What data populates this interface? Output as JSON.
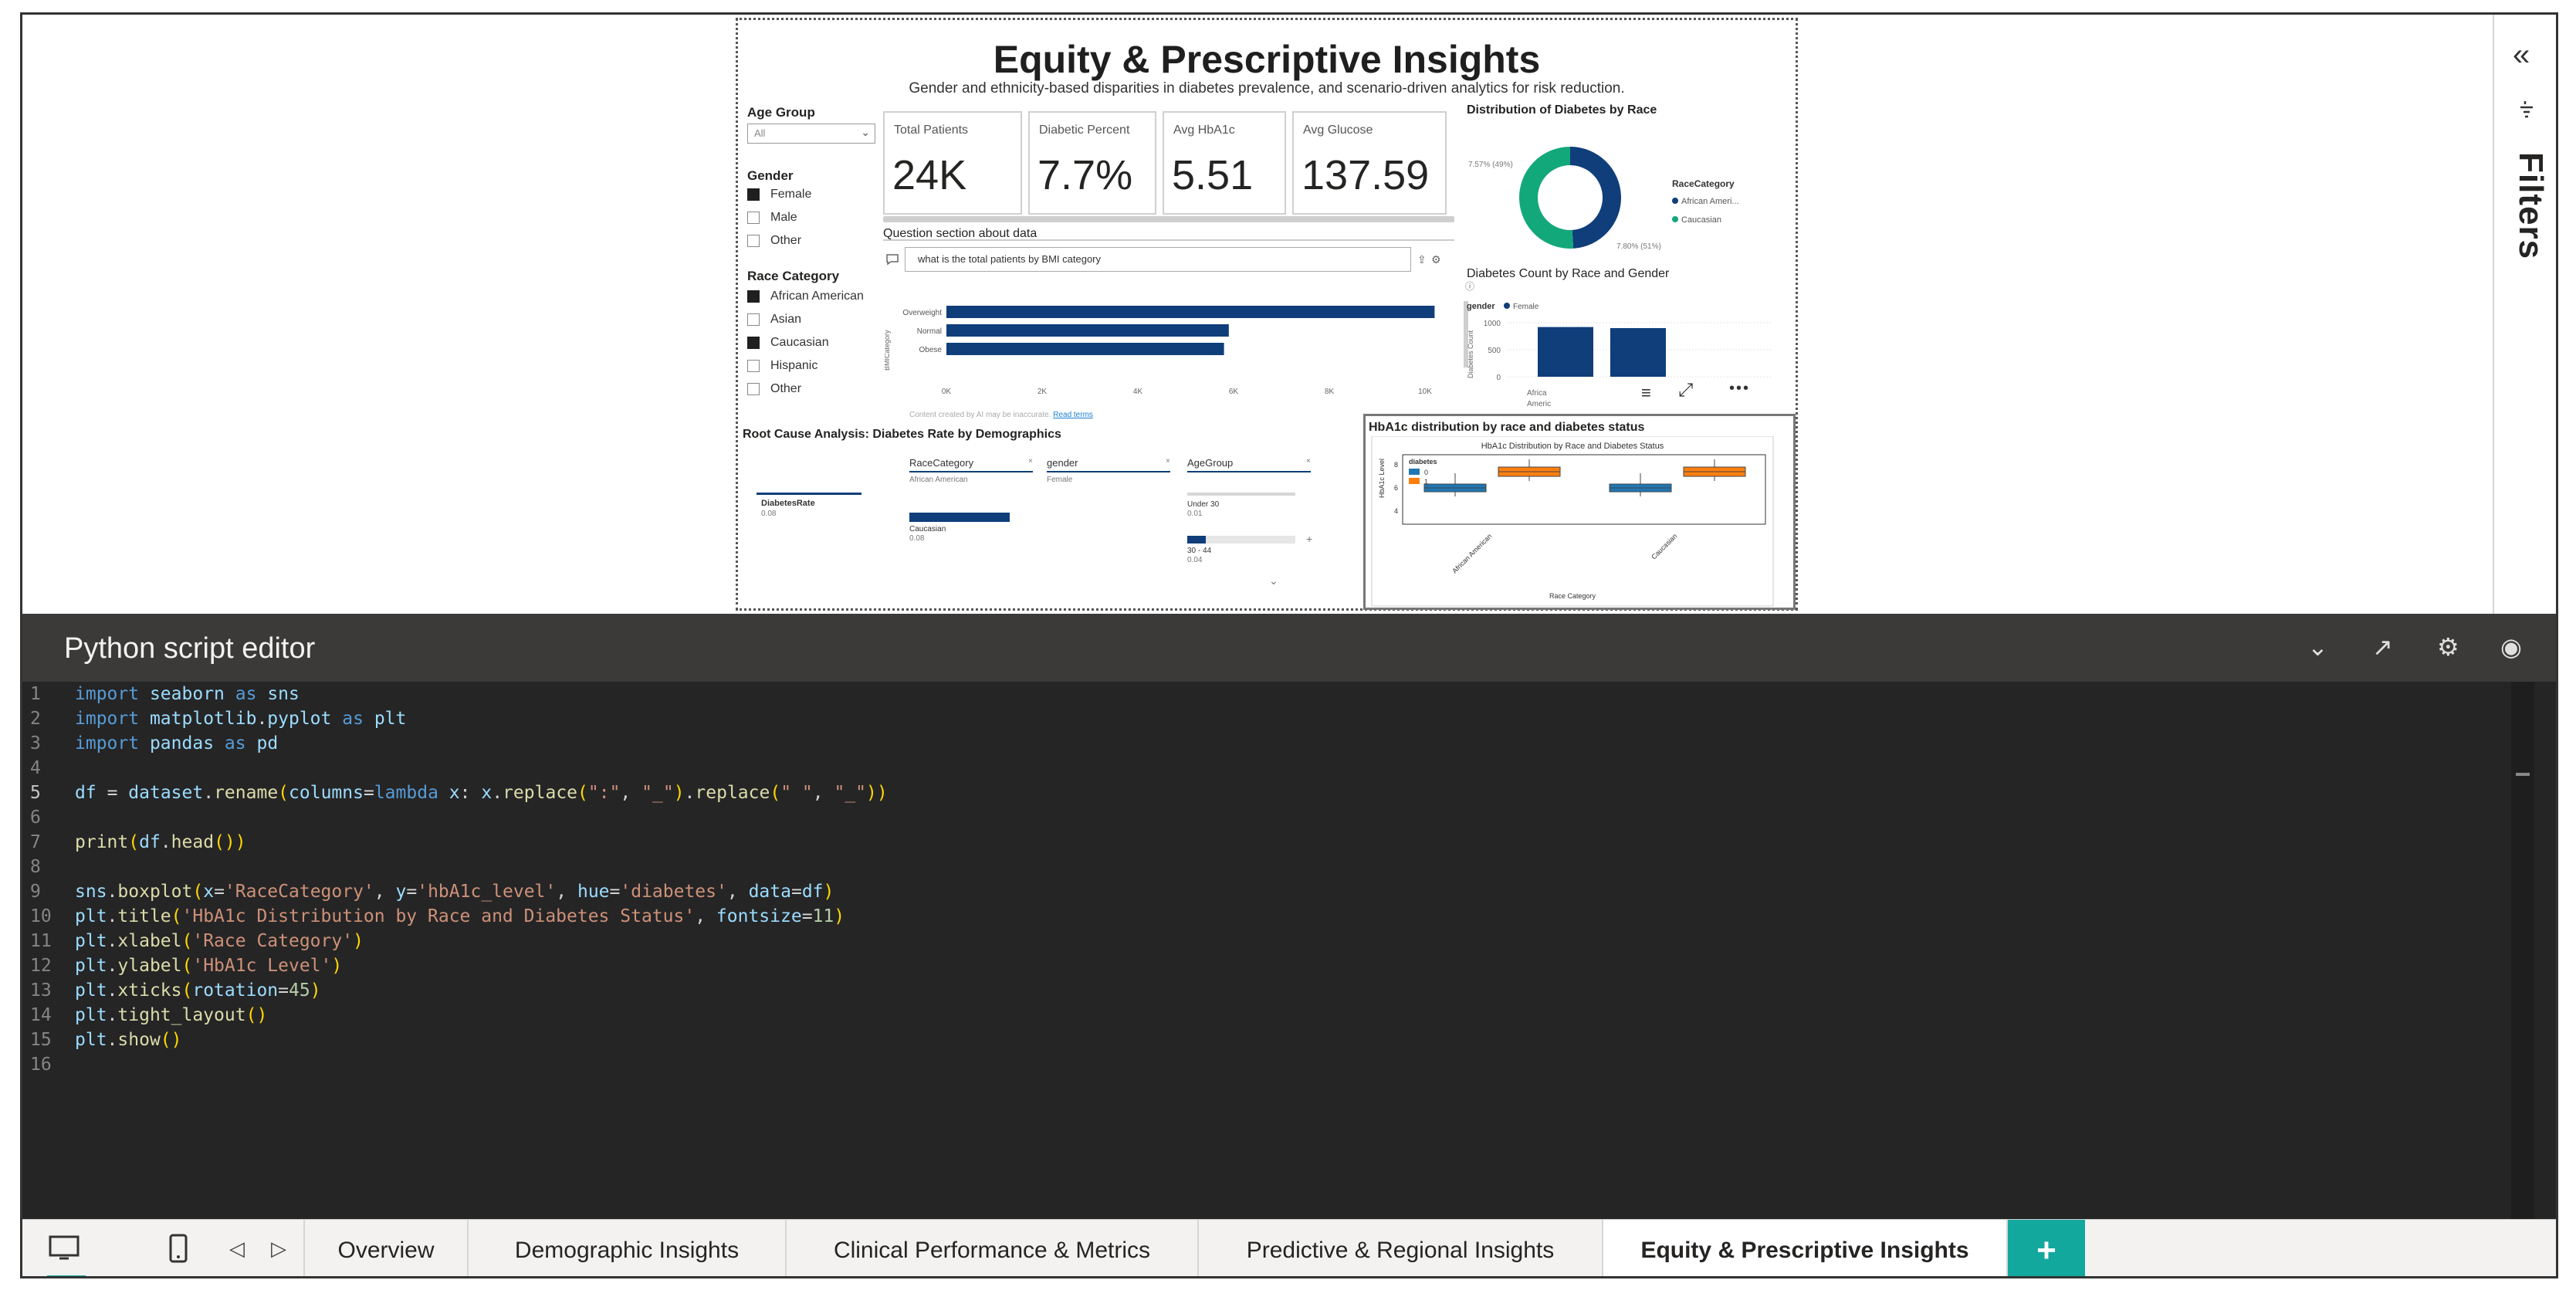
{
  "report": {
    "title": "Equity & Prescriptive Insights",
    "subtitle": "Gender and ethnicity-based disparities in diabetes prevalence, and scenario-driven analytics for risk reduction."
  },
  "slicers": {
    "age_group": {
      "title": "Age Group",
      "selected": "All"
    },
    "gender": {
      "title": "Gender",
      "options": [
        {
          "label": "Female",
          "checked": true
        },
        {
          "label": "Male",
          "checked": false
        },
        {
          "label": "Other",
          "checked": false
        }
      ]
    },
    "race": {
      "title": "Race Category",
      "options": [
        {
          "label": "African American",
          "checked": true
        },
        {
          "label": "Asian",
          "checked": false
        },
        {
          "label": "Caucasian",
          "checked": true
        },
        {
          "label": "Hispanic",
          "checked": false
        },
        {
          "label": "Other",
          "checked": false
        }
      ]
    }
  },
  "cards": [
    {
      "label": "Total Patients",
      "value": "24K"
    },
    {
      "label": "Diabetic Percent",
      "value": "7.7%"
    },
    {
      "label": "Avg HbA1c",
      "value": "5.51"
    },
    {
      "label": "Avg Glucose",
      "value": "137.59"
    }
  ],
  "qa": {
    "title": "Question section about data",
    "question": "what is the total patients by BMI category",
    "footer": "Content created by AI may be inaccurate.",
    "read_terms": "Read terms",
    "axis_label": "BMICategory",
    "chart_data": {
      "type": "bar",
      "orientation": "horizontal",
      "categories": [
        "Overweight",
        "Normal",
        "Obese"
      ],
      "values": [
        10200,
        5900,
        5800
      ],
      "xticks": [
        "0K",
        "2K",
        "4K",
        "6K",
        "8K",
        "10K"
      ],
      "xlim": [
        0,
        10000
      ],
      "color": "#0f3e7a"
    }
  },
  "donut": {
    "title": "Distribution of Diabetes by Race",
    "label_left": "7.57% (49%)",
    "label_right": "7.80% (51%)",
    "legend_title": "RaceCategory",
    "chart_data": {
      "type": "pie",
      "categories": [
        "African Ameri...",
        "Caucasian"
      ],
      "values": [
        49,
        51
      ],
      "colors": [
        "#0f3e7a",
        "#13a87a"
      ]
    }
  },
  "gender_bars": {
    "title": "Diabetes Count by Race and Gender",
    "legend_title": "gender",
    "legend_item": "Female",
    "ylabel": "Diabetes Count",
    "yticks": [
      "1000",
      "500",
      "0"
    ],
    "x_label_1": "Africa",
    "x_label_2": "Americ",
    "chart_data": {
      "type": "bar",
      "categories": [
        "African American",
        "Caucasian"
      ],
      "series": [
        {
          "name": "Female",
          "values": [
            920,
            900
          ]
        }
      ],
      "ylim": [
        0,
        1000
      ],
      "color": "#0f3e7a"
    }
  },
  "decomp": {
    "title": "Root Cause Analysis: Diabetes Rate by Demographics",
    "root_label": "DiabetesRate",
    "root_value": "0.08",
    "columns": [
      {
        "header": "RaceCategory",
        "sub": "African American"
      },
      {
        "header": "gender",
        "sub": "Female"
      },
      {
        "header": "AgeGroup",
        "sub": ""
      }
    ],
    "race_node": {
      "label": "Caucasian",
      "value": "0.08"
    },
    "age_nodes": [
      {
        "label": "Under 30",
        "value": "0.01"
      },
      {
        "label": "30 - 44",
        "value": "0.04"
      }
    ]
  },
  "boxplot": {
    "title": "HbA1c distribution by race and diabetes status",
    "inner_title": "HbA1c Distribution by Race and Diabetes Status",
    "xlabel": "Race Category",
    "ylabel": "HbA1c Level",
    "legend_title": "diabetes",
    "legend_items": [
      "0",
      "1"
    ],
    "yticks": [
      "8",
      "6",
      "4"
    ],
    "categories": [
      "African American",
      "Caucasian"
    ],
    "colors": [
      "#1f77b4",
      "#ff7f0e"
    ]
  },
  "filters_pane": {
    "title": "Filters",
    "collapse_icon": "chevron-double-left-icon"
  },
  "editor": {
    "title": "Python script editor",
    "lines": [
      "import seaborn as sns",
      "import matplotlib.pyplot as plt",
      "import pandas as pd",
      "",
      "df = dataset.rename(columns=lambda x: x.replace(\":\", \"_\").replace(\" \", \"_\"))",
      "",
      "print(df.head())",
      "",
      "sns.boxplot(x='RaceCategory', y='hbA1c_level', hue='diabetes', data=df)",
      "plt.title('HbA1c Distribution by Race and Diabetes Status', fontsize=11)",
      "plt.xlabel('Race Category')",
      "plt.ylabel('HbA1c Level')",
      "plt.xticks(rotation=45)",
      "plt.tight_layout()",
      "plt.show()",
      ""
    ]
  },
  "tabs": [
    {
      "label": "Overview",
      "active": false
    },
    {
      "label": "Demographic Insights",
      "active": false
    },
    {
      "label": "Clinical Performance & Metrics",
      "active": false
    },
    {
      "label": "Predictive & Regional Insights",
      "active": false
    },
    {
      "label": "Equity & Prescriptive Insights",
      "active": true
    }
  ],
  "add_page_label": "+"
}
